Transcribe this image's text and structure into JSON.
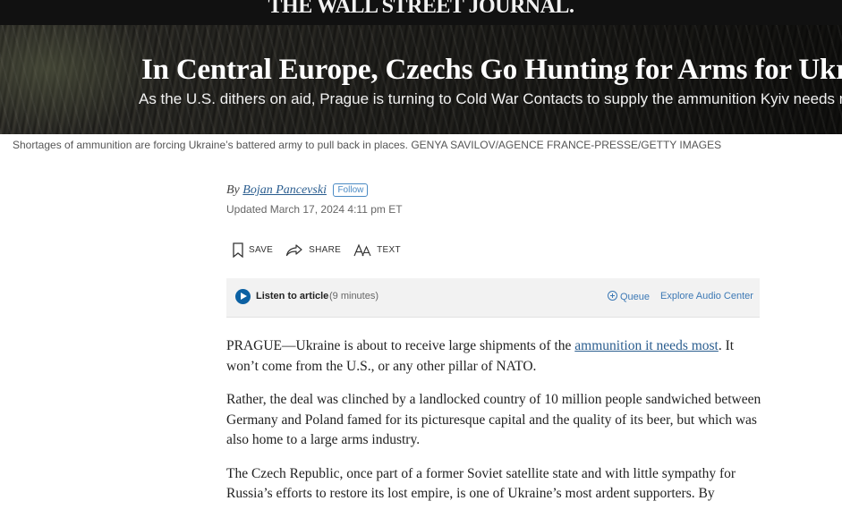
{
  "masthead": {
    "logo": "THE WALL STREET JOURNAL."
  },
  "hero": {
    "headline": "In Central Europe, Czechs Go Hunting for Arms for Ukraine",
    "dek": "As the U.S. dithers on aid, Prague is turning to Cold War Contacts to supply the ammunition Kyiv needs most"
  },
  "caption": "Shortages of ammunition are forcing Ukraine’s battered army to pull back in places. GENYA SAVILOV/AGENCE FRANCE-PRESSE/GETTY IMAGES",
  "byline": {
    "prefix": "By",
    "author": "Bojan Pancevski",
    "follow_label": "Follow",
    "updated": "Updated March 17, 2024 4:11 pm ET"
  },
  "tools": {
    "save_label": "SAVE",
    "share_label": "SHARE",
    "text_label": "TEXT"
  },
  "audio": {
    "listen_label": "Listen to article",
    "duration": "(9 minutes)",
    "queue_label": "Queue",
    "explore_label": "Explore Audio Center"
  },
  "article": {
    "p1_before": "PRAGUE—Ukraine is about to receive large shipments of the",
    "p1_link": "ammunition it needs most",
    "p1_after": ". It won’t come from the U.S., or any other pillar of NATO.",
    "p2": "Rather, the deal was clinched by a landlocked country of 10 million people sandwiched between Germany and Poland famed for its picturesque capital and the quality of its beer, but which was also home to a large arms industry.",
    "p3": "The Czech Republic, once part of a former Soviet satellite state and with little sympathy for Russia’s efforts to restore its lost empire, is one of Ukraine’s most ardent supporters. By"
  }
}
